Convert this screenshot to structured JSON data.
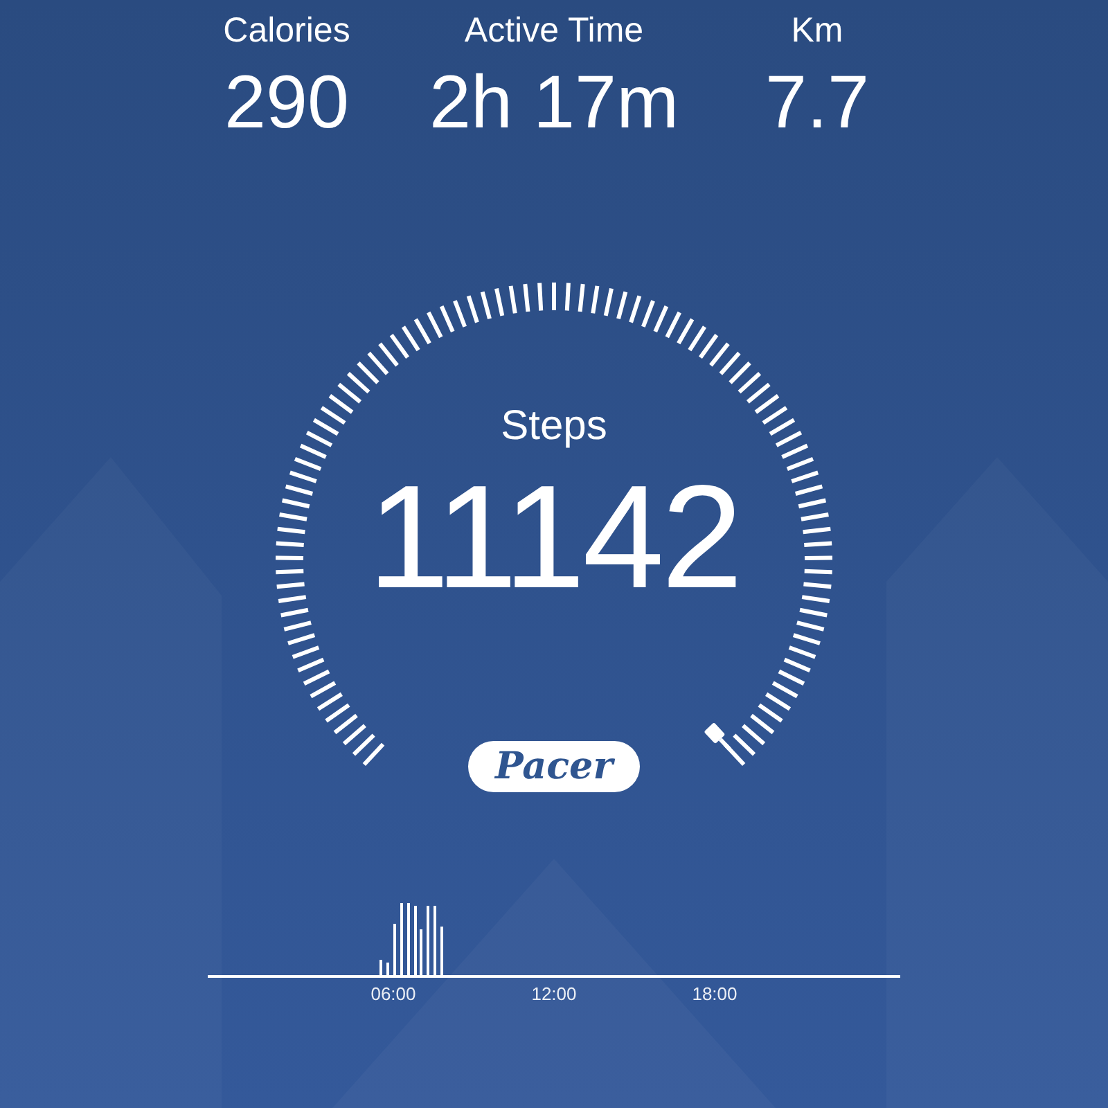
{
  "stats": [
    {
      "label": "Calories",
      "value": "290"
    },
    {
      "label": "Active Time",
      "value": "2h 17m"
    },
    {
      "label": "Km",
      "value": "7.7"
    }
  ],
  "gauge": {
    "label": "Steps",
    "value": "11142"
  },
  "logo": "Pacer",
  "activity_chart": {
    "x_labels": [
      "06:00",
      "12:00",
      "18:00"
    ]
  }
}
